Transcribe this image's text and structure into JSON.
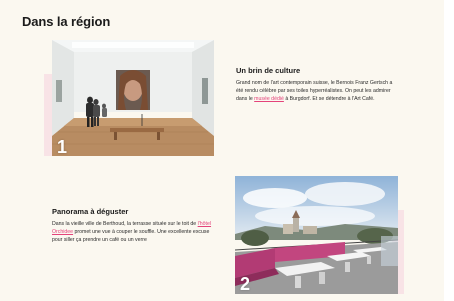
{
  "section": {
    "title": "Dans la région"
  },
  "items": [
    {
      "number": "1",
      "title": "Un brin de culture",
      "text_before": "Grand nom de l'art contemporain suisse, le Bernois Franz Gertsch a été rendu célèbre par ses toiles hyperréalistes. On peut les admirer dans le ",
      "link": "musée dédié",
      "text_after": " à Burgdorf. Et se détendre à l'Art Café."
    },
    {
      "number": "2",
      "title": "Panorama à déguster",
      "text_before": "Dans la vieille ville de Berthoud, la terrasse située sur le toit de ",
      "link": "l'hôtel Orchidee",
      "text_after": " promet une vue à couper le souffle. Une excellente excuse pour siller ça prendre un café ou un verre"
    }
  ]
}
